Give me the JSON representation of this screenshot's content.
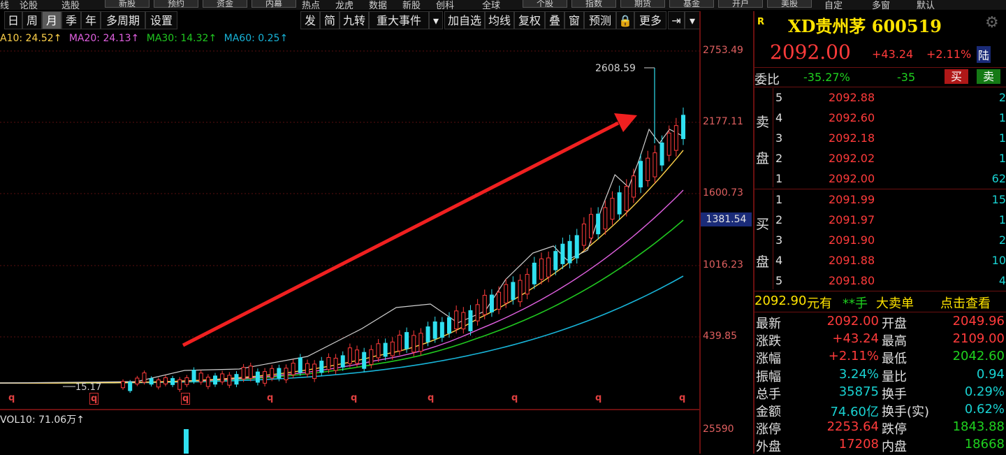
{
  "menu": {
    "items": [
      "线",
      "论股",
      "选股",
      "热点",
      "龙虎",
      "数据",
      "新股",
      "创科",
      "全球",
      "自定",
      "多窗",
      "默认"
    ],
    "buttons": [
      "新股",
      "预约",
      "资金",
      "内幕",
      "个股",
      "指数",
      "期货",
      "基金",
      "开户",
      "美股"
    ]
  },
  "periods": [
    "日",
    "周",
    "月",
    "季",
    "年",
    "多周期",
    "设置"
  ],
  "active_period": "月",
  "tools": [
    "发",
    "简",
    "九转",
    "重大事件",
    "▾",
    "加自选",
    "均线",
    "复权",
    "叠",
    "窗",
    "预测",
    "🔒",
    "更多",
    "⇥",
    "▾"
  ],
  "ma": {
    "ma10": "A10: 24.52↑",
    "ma20": "MA20: 24.13↑",
    "ma30": "MA30: 14.32↑",
    "ma60": "MA60: 0.25↑"
  },
  "colors": {
    "ma10": "#ffd24a",
    "ma20": "#e060e0",
    "ma30": "#20c820",
    "ma60": "#18b4d8",
    "price": "#d0d0d0",
    "up": "#ff3b3b",
    "down": "#30e0f0",
    "arrow": "#f02020"
  },
  "axis": {
    "labels": [
      "2753.49",
      "2177.11",
      "1600.73",
      "1016.23",
      "439.85"
    ],
    "current": "1381.54",
    "vol_label": "25590"
  },
  "annotation": {
    "high_label": "2608.59",
    "low_label": "15.17"
  },
  "q_markers": [
    "q",
    "q",
    "q",
    "q",
    "q",
    "q",
    "q",
    "q",
    "q"
  ],
  "vol": {
    "label": "VOL10: 71.06万↑"
  },
  "quote": {
    "badge": "R",
    "name": "XD贵州茅 600519",
    "price": "2092.00",
    "change": "+43.24",
    "pct": "+2.11%",
    "market": "陆",
    "ratio_label": "委比",
    "ratio": "-35.27%",
    "ratio_diff": "-35",
    "buy_btn": "买",
    "sell_btn": "卖",
    "sell_label1": "卖",
    "sell_label2": "盘",
    "buy_label1": "买",
    "buy_label2": "盘",
    "asks": [
      {
        "lv": "5",
        "p": "2092.88",
        "v": "2"
      },
      {
        "lv": "4",
        "p": "2092.60",
        "v": "1"
      },
      {
        "lv": "3",
        "p": "2092.18",
        "v": "1"
      },
      {
        "lv": "2",
        "p": "2092.02",
        "v": "1"
      },
      {
        "lv": "1",
        "p": "2092.00",
        "v": "62"
      }
    ],
    "bids": [
      {
        "lv": "1",
        "p": "2091.99",
        "v": "15"
      },
      {
        "lv": "2",
        "p": "2091.97",
        "v": "1"
      },
      {
        "lv": "3",
        "p": "2091.90",
        "v": "2"
      },
      {
        "lv": "4",
        "p": "2091.88",
        "v": "10"
      },
      {
        "lv": "5",
        "p": "2091.80",
        "v": "4"
      }
    ],
    "bigorder": {
      "price": "2092.90",
      "unit": "元有",
      "hand": "**手",
      "label": "大卖单",
      "link": "点击查看"
    },
    "stats": [
      {
        "k1": "最新",
        "v1": "2092.00",
        "c1": "red",
        "k2": "开盘",
        "v2": "2049.96",
        "c2": "red"
      },
      {
        "k1": "涨跌",
        "v1": "+43.24",
        "c1": "red",
        "k2": "最高",
        "v2": "2109.00",
        "c2": "red"
      },
      {
        "k1": "涨幅",
        "v1": "+2.11%",
        "c1": "red",
        "k2": "最低",
        "v2": "2042.60",
        "c2": "grn"
      },
      {
        "k1": "振幅",
        "v1": "3.24%",
        "c1": "cyan",
        "k2": "量比",
        "v2": "0.94",
        "c2": "cyan"
      },
      {
        "k1": "总手",
        "v1": "35875",
        "c1": "cyan",
        "k2": "换手",
        "v2": "0.29%",
        "c2": "cyan"
      },
      {
        "k1": "金额",
        "v1": "74.60亿",
        "c1": "cyan",
        "k2": "换手(实)",
        "v2": "0.62%",
        "c2": "cyan"
      },
      {
        "k1": "涨停",
        "v1": "2253.64",
        "c1": "red",
        "k2": "跌停",
        "v2": "1843.88",
        "c2": "grn"
      },
      {
        "k1": "外盘",
        "v1": "17208",
        "c1": "red",
        "k2": "内盘",
        "v2": "18668",
        "c2": "grn"
      }
    ]
  }
}
